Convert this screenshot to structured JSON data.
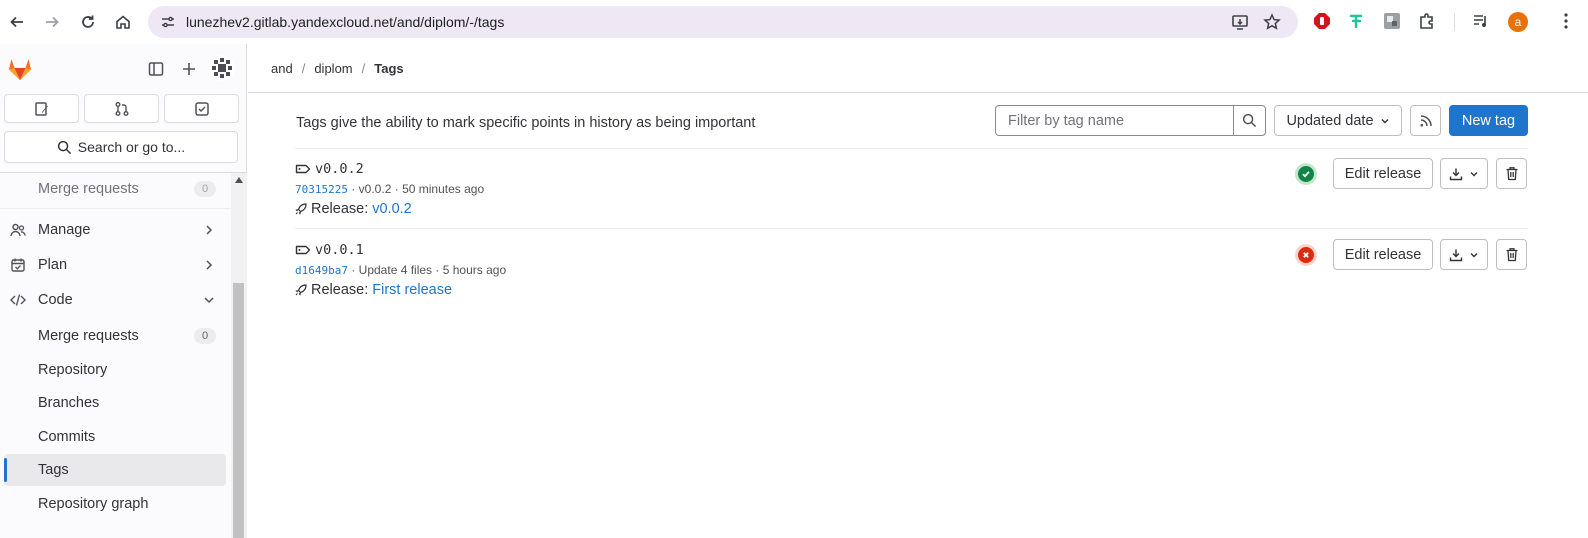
{
  "browser": {
    "url": "lunezhev2.gitlab.yandexcloud.net/and/diplom/-/tags",
    "profile_initial": "a",
    "profile_color": "#e8710a"
  },
  "sidebar": {
    "search_label": "Search or go to...",
    "items": [
      {
        "label": "Merge requests",
        "badge": "0"
      },
      {
        "label": "Manage"
      },
      {
        "label": "Plan"
      },
      {
        "label": "Code"
      },
      {
        "label": "Merge requests",
        "badge": "0"
      },
      {
        "label": "Repository"
      },
      {
        "label": "Branches"
      },
      {
        "label": "Commits"
      },
      {
        "label": "Tags"
      },
      {
        "label": "Repository graph"
      }
    ]
  },
  "breadcrumb": [
    "and",
    "diplom",
    "Tags"
  ],
  "main": {
    "intro": "Tags give the ability to mark specific points in history as being important",
    "filter_placeholder": "Filter by tag name",
    "sort_label": "Updated date",
    "new_tag_label": "New tag",
    "edit_release_label": "Edit release",
    "release_prefix": "Release:",
    "tags": [
      {
        "name": "v0.0.2",
        "sha": "70315225",
        "message": "v0.0.2",
        "time": "50 minutes ago",
        "release": "v0.0.2",
        "pipeline_status": "success"
      },
      {
        "name": "v0.0.1",
        "sha": "d1649ba7",
        "message": "Update 4 files",
        "time": "5 hours ago",
        "release": "First release",
        "pipeline_status": "failed"
      }
    ]
  },
  "colors": {
    "accent": "#1f75cb",
    "success": "#108548",
    "failed": "#dd2b0e"
  }
}
